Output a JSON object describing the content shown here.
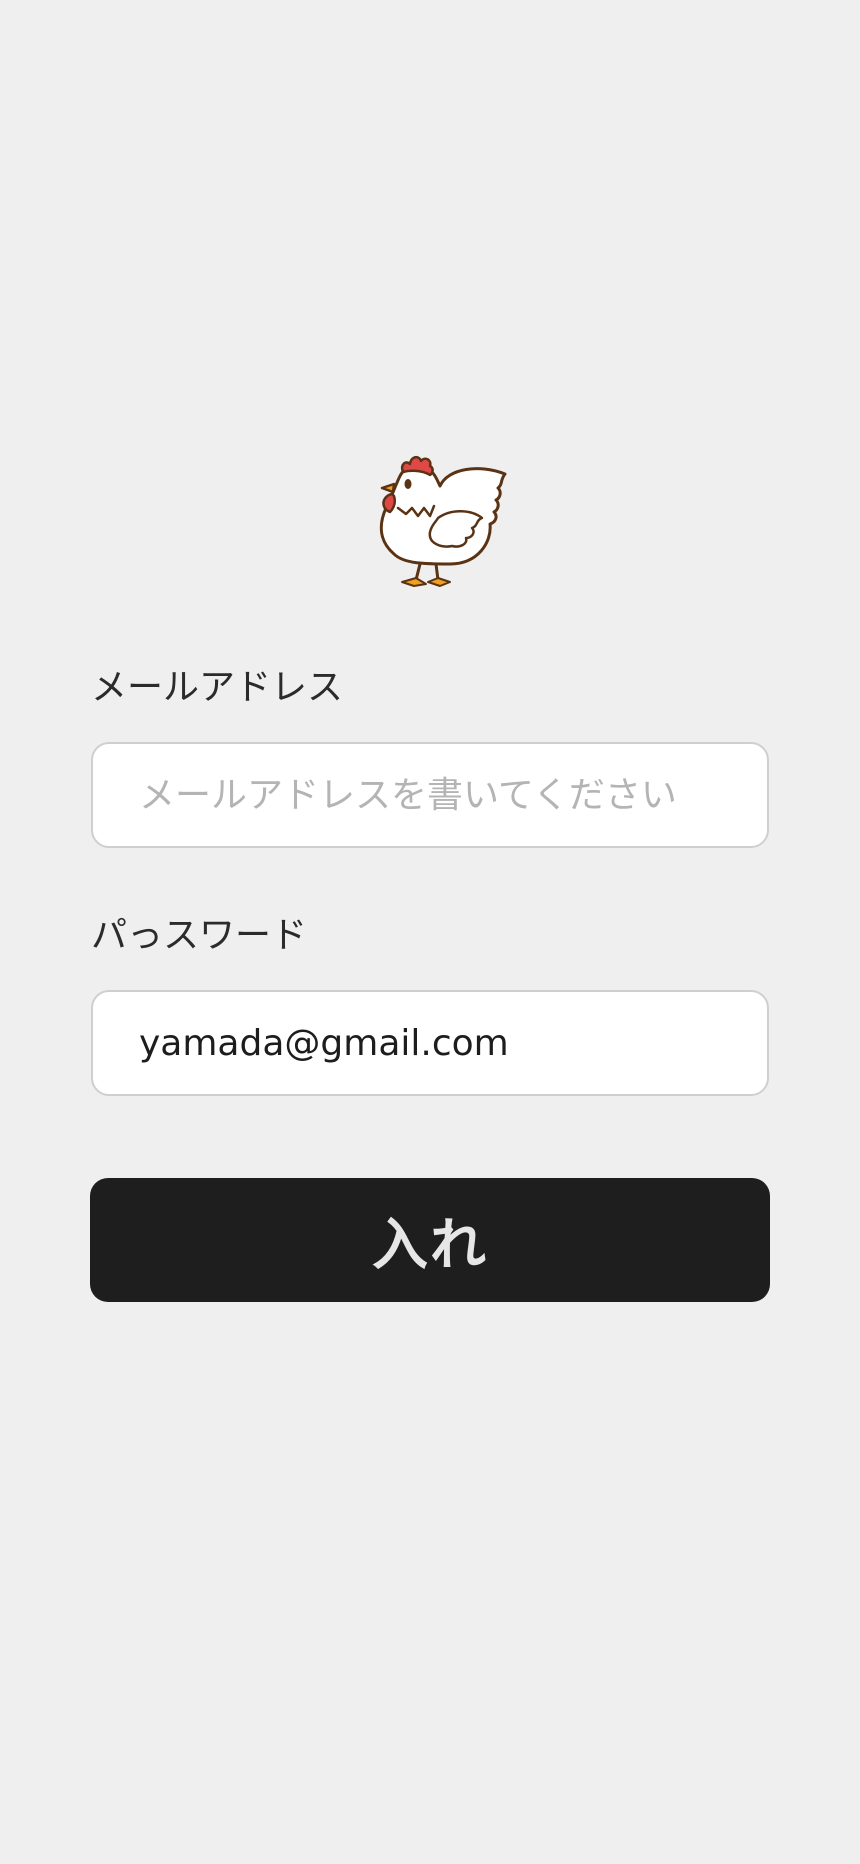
{
  "logo": {
    "icon": "chicken-icon",
    "colors": {
      "comb": "#e04848",
      "outline": "#5a3214",
      "beak": "#f0a020",
      "feet": "#f0a020",
      "body": "#ffffff"
    }
  },
  "form": {
    "email_label": "メールアドレス",
    "email_placeholder": "メールアドレスを書いてください",
    "email_value": "",
    "password_label": "パっスワード",
    "password_value": "yamada@gmail.com",
    "submit_label": "入れ"
  },
  "theme": {
    "background": "#efefef",
    "button": "#1e1e1e",
    "button_text": "#e6e6e6",
    "field_border": "#cfcfcf"
  }
}
